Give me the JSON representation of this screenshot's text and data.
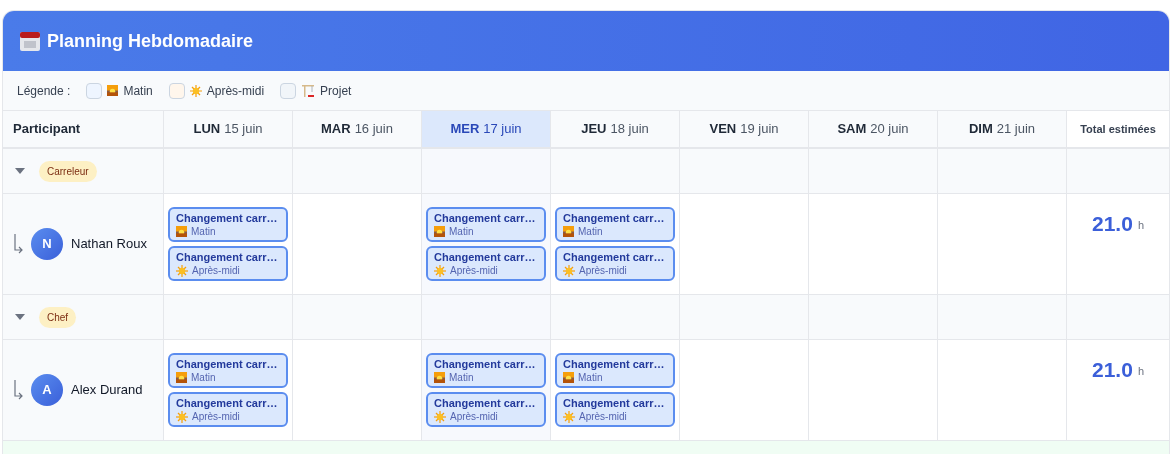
{
  "header": {
    "title": "Planning Hebdomadaire"
  },
  "legend": {
    "label": "Légende :",
    "items": [
      {
        "kind": "morning",
        "label": "Matin",
        "color": "#eef5ff"
      },
      {
        "kind": "afternoon",
        "label": "Après-midi",
        "color": "#fff6ec"
      },
      {
        "kind": "project",
        "label": "Projet",
        "color": "#f1f5f9"
      }
    ]
  },
  "columns": {
    "participant": "Participant",
    "total": "Total estimées",
    "days": [
      {
        "day": "LUN",
        "date": "15 juin",
        "selected": false
      },
      {
        "day": "MAR",
        "date": "16 juin",
        "selected": false
      },
      {
        "day": "MER",
        "date": "17 juin",
        "selected": true
      },
      {
        "day": "JEU",
        "date": "18 juin",
        "selected": false
      },
      {
        "day": "VEN",
        "date": "19 juin",
        "selected": false
      },
      {
        "day": "SAM",
        "date": "20 juin",
        "selected": false
      },
      {
        "day": "DIM",
        "date": "21 juin",
        "selected": false
      }
    ]
  },
  "groups": [
    {
      "label": "Carreleur",
      "expanded": true,
      "people": [
        {
          "initial": "N",
          "name": "Nathan Roux",
          "total": "21.0",
          "unit": "h",
          "days": [
            {
              "kind": "busy",
              "events": [
                {
                  "kind": "morning",
                  "title": "Changement carr…",
                  "slot": "Matin"
                },
                {
                  "kind": "afternoon",
                  "title": "Changement carr…",
                  "slot": "Après-midi"
                }
              ]
            },
            {
              "kind": "free"
            },
            {
              "kind": "busy",
              "events": [
                {
                  "kind": "morning",
                  "title": "Changement carr…",
                  "slot": "Matin"
                },
                {
                  "kind": "afternoon",
                  "title": "Changement carr…",
                  "slot": "Après-midi"
                }
              ]
            },
            {
              "kind": "busy",
              "events": [
                {
                  "kind": "morning",
                  "title": "Changement carr…",
                  "slot": "Matin"
                },
                {
                  "kind": "afternoon",
                  "title": "Changement carr…",
                  "slot": "Après-midi"
                }
              ]
            },
            {
              "kind": "free"
            },
            {
              "kind": "free"
            },
            {
              "kind": "free"
            }
          ]
        }
      ]
    },
    {
      "label": "Chef",
      "expanded": true,
      "people": [
        {
          "initial": "A",
          "name": "Alex Durand",
          "total": "21.0",
          "unit": "h",
          "days": [
            {
              "kind": "busy",
              "events": [
                {
                  "kind": "morning",
                  "title": "Changement carr…",
                  "slot": "Matin"
                },
                {
                  "kind": "afternoon",
                  "title": "Changement carr…",
                  "slot": "Après-midi"
                }
              ]
            },
            {
              "kind": "free"
            },
            {
              "kind": "busy",
              "events": [
                {
                  "kind": "morning",
                  "title": "Changement carr…",
                  "slot": "Matin"
                },
                {
                  "kind": "afternoon",
                  "title": "Changement carr…",
                  "slot": "Après-midi"
                }
              ]
            },
            {
              "kind": "busy",
              "events": [
                {
                  "kind": "morning",
                  "title": "Changement carr…",
                  "slot": "Matin"
                },
                {
                  "kind": "afternoon",
                  "title": "Changement carr…",
                  "slot": "Après-midi"
                }
              ]
            },
            {
              "kind": "free"
            },
            {
              "kind": "free"
            },
            {
              "kind": "free"
            }
          ]
        }
      ]
    }
  ]
}
